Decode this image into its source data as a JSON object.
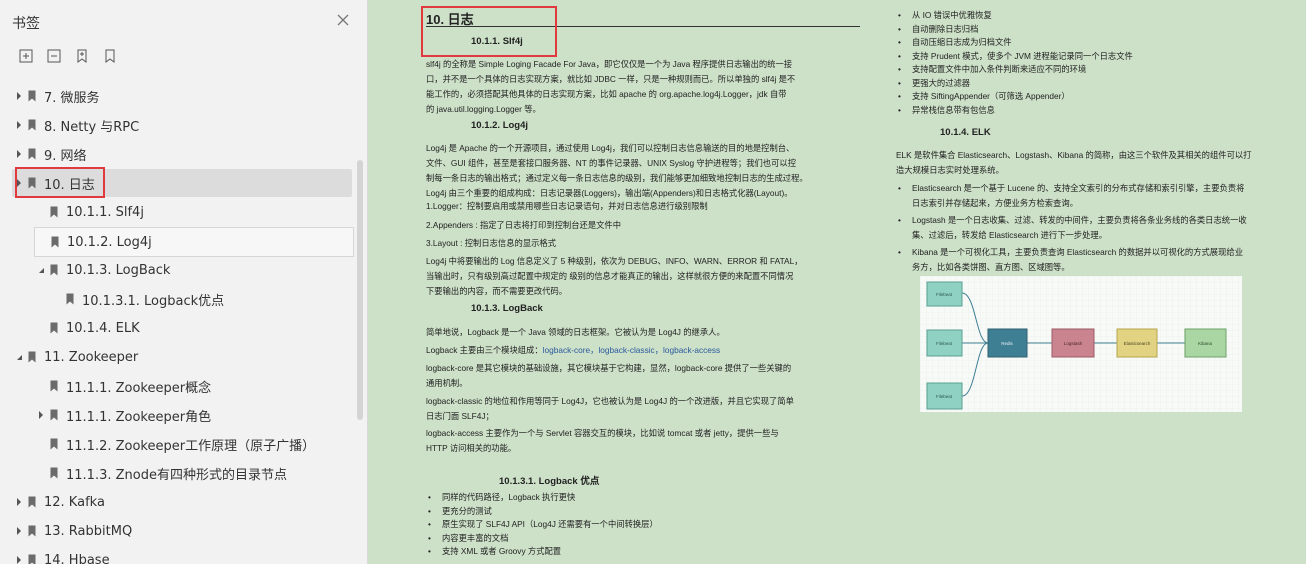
{
  "sidebar": {
    "title": "书签",
    "close_icon": "close-icon",
    "tools": [
      "expand-all-icon",
      "collapse-all-icon",
      "add-bookmark-icon",
      "bookmark-icon"
    ],
    "items": [
      {
        "label": "7.   微服务",
        "level": 0,
        "expand": "collapsed"
      },
      {
        "label": "8. Netty 与RPC",
        "level": 0,
        "expand": "collapsed"
      },
      {
        "label": "9. 网络",
        "level": 0,
        "expand": "collapsed"
      },
      {
        "label": "10. 日志",
        "level": 0,
        "expand": "collapsed",
        "selected": true
      },
      {
        "label": "10.1.1. Slf4j",
        "level": 1,
        "expand": "none"
      },
      {
        "label": "10.1.2. Log4j",
        "level": 1,
        "expand": "none",
        "hover": true
      },
      {
        "label": "10.1.3. LogBack",
        "level": 1,
        "expand": "expanded"
      },
      {
        "label": "10.1.3.1.   Logback优点",
        "level": 2,
        "expand": "none"
      },
      {
        "label": "10.1.4. ELK",
        "level": 1,
        "expand": "none"
      },
      {
        "label": "11. Zookeeper",
        "level": 0,
        "expand": "expanded"
      },
      {
        "label": "11.1.1. Zookeeper概念",
        "level": 1,
        "expand": "none"
      },
      {
        "label": "11.1.1. Zookeeper角色",
        "level": 1,
        "expand": "collapsed"
      },
      {
        "label": "11.1.2. Zookeeper工作原理（原子广播）",
        "level": 1,
        "expand": "none"
      },
      {
        "label": "11.1.3.    Znode有四种形式的目录节点",
        "level": 1,
        "expand": "none"
      },
      {
        "label": "12. Kafka",
        "level": 0,
        "expand": "collapsed"
      },
      {
        "label": "13. RabbitMQ",
        "level": 0,
        "expand": "collapsed"
      },
      {
        "label": "14. Hbase",
        "level": 0,
        "expand": "collapsed"
      }
    ]
  },
  "left": {
    "h_log": "10.  日志",
    "h_slf4j": "10.1.1.    Slf4j",
    "p_slf4j": [
      "slf4j 的全称是 Simple Loging Facade For Java，即它仅仅是一个为 Java 程序提供日志输出的统一接",
      "口，并不是一个具体的日志实现方案，就比如 JDBC 一样，只是一种规则而已。所以单独的 slf4j 是不",
      "能工作的，必须搭配其他具体的日志实现方案，比如 apache 的 org.apache.log4j.Logger，jdk 自带",
      "的 java.util.logging.Logger 等。"
    ],
    "h_log4j": "10.1.2.    Log4j",
    "p_log4j": [
      "Log4j 是 Apache 的一个开源项目，通过使用 Log4j，我们可以控制日志信息输送的目的地是控制台、",
      "文件、GUI 组件，甚至是套接口服务器、NT 的事件记录器、UNIX Syslog 守护进程等；我们也可以控",
      "制每一条日志的输出格式；通过定义每一条日志信息的级别，我们能够更加细致地控制日志的生成过程。",
      "Log4j 由三个重要的组成构成：日志记录器(Loggers)，输出端(Appenders)和日志格式化器(Layout)。"
    ],
    "l1": "1.Logger：控制要启用或禁用哪些日志记录语句，并对日志信息进行级别限制",
    "l2": "2.Appenders : 指定了日志将打印到控制台还是文件中",
    "l3": "3.Layout : 控制日志信息的显示格式",
    "p_levels": [
      "Log4j 中将要输出的 Log 信息定义了 5 种级别，依次为 DEBUG、INFO、WARN、ERROR 和 FATAL，",
      "当输出时，只有级别高过配置中规定的 级别的信息才能真正的输出，这样就很方便的来配置不同情况",
      "下要输出的内容，而不需要更改代码。"
    ],
    "h_logback": "10.1.3.    LogBack",
    "p_lb1": "简单地说，Logback 是一个 Java 领域的日志框架。它被认为是 Log4J 的继承人。",
    "p_lb2_pre": "Logback 主要由三个模块组成：",
    "p_lb2_mods": "logback-core，logback-classic，logback-access",
    "p_lb3": [
      "logback-core 是其它模块的基础设施，其它模块基于它构建，显然，logback-core 提供了一些关键的",
      "通用机制。"
    ],
    "p_lb4": [
      "logback-classic 的地位和作用等同于 Log4J，它也被认为是 Log4J 的一个改进版，并且它实现了简单",
      "日志门面 SLF4J；"
    ],
    "p_lb5": [
      " logback-access 主要作为一个与 Servlet 容器交互的模块，比如说 tomcat 或者 jetty，提供一些与",
      "HTTP 访问相关的功能。"
    ],
    "h_lbadv": "10.1.3.1.    Logback 优点",
    "adv": [
      "同样的代码路径，Logback 执行更快",
      "更充分的测试",
      "原生实现了 SLF4J API（Log4J 还需要有一个中间转换层）",
      "内容更丰富的文档",
      "支持 XML 或者 Groovy 方式配置"
    ]
  },
  "right": {
    "bullets": [
      "从 IO 错误中优雅恢复",
      "自动删除日志归档",
      "自动压缩日志成为归档文件",
      "支持 Prudent 模式，使多个 JVM 进程能记录同一个日志文件",
      "支持配置文件中加入条件判断来适应不同的环境",
      "更强大的过滤器",
      "支持 SiftingAppender（可筛选 Appender）",
      "异常栈信息带有包信息"
    ],
    "h_elk": "10.1.4.    ELK",
    "p_elk": [
      "ELK 是软件集合 Elasticsearch、Logstash、Kibana 的简称，由这三个软件及其相关的组件可以打",
      "造大规模日志实时处理系统。"
    ],
    "elk_items": [
      [
        "Elasticsearch 是一个基于 Lucene 的、支持全文索引的分布式存储和索引引擎，主要负责将",
        "日志索引并存储起来，方便业务方检索查询。"
      ],
      [
        "Logstash 是一个日志收集、过滤、转发的中间件，主要负责将各条业务线的各类日志统一收",
        "集、过滤后，转发给 Elasticsearch 进行下一步处理。"
      ],
      [
        "Kibana 是一个可视化工具，主要负责查询 Elasticsearch 的数据并以可视化的方式展现给业",
        "务方，比如各类饼图、直方图、区域图等。"
      ]
    ],
    "diagram": {
      "filebeat": "Filebeat",
      "redis": "Redis",
      "logstash": "Logstash",
      "elasticsearch": "Elasticsearch",
      "kibana": "Kibana"
    }
  },
  "colors": {
    "page_bg": "#cde0c8",
    "highlight": "#e0393e",
    "link": "#2b5a9e",
    "filebeat": "#8fd1c3",
    "redis": "#3f7f94",
    "logstash": "#c9848f",
    "elasticsearch": "#e2d383",
    "kibana": "#a9d6a3"
  }
}
